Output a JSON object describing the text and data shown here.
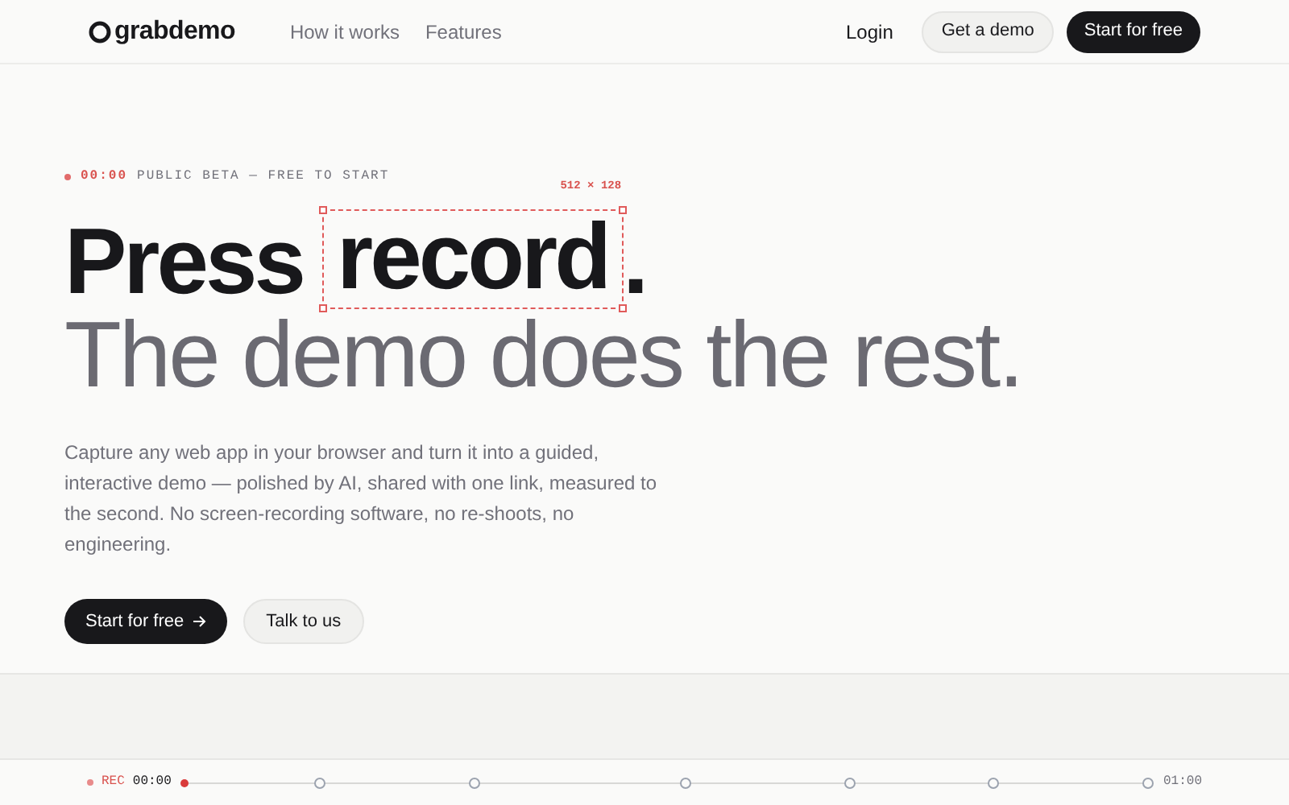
{
  "nav": {
    "logo": "grabdemo",
    "links": [
      "How it works",
      "Features"
    ],
    "login": "Login",
    "demo_button": "Get a demo",
    "start_button": "Start for free"
  },
  "hero": {
    "eyebrow_time": "00:00",
    "eyebrow": "PUBLIC BETA — FREE TO START",
    "selection_size": "512 × 128",
    "headline_before": "Press",
    "headline_selected": "record",
    "headline_after": ".",
    "subheadline": "The demo does the rest.",
    "description": "Capture any web app in your browser and turn it into a guided, interactive demo — polished by AI, shared with one link, measured to the second. No screen-recording software, no re-shoots, no engineering.",
    "primary_button": "Start for free",
    "secondary_button": "Talk to us"
  },
  "timeline": {
    "rec": "REC",
    "current_time": "00:00",
    "end_time": "01:00",
    "level": 0
  }
}
